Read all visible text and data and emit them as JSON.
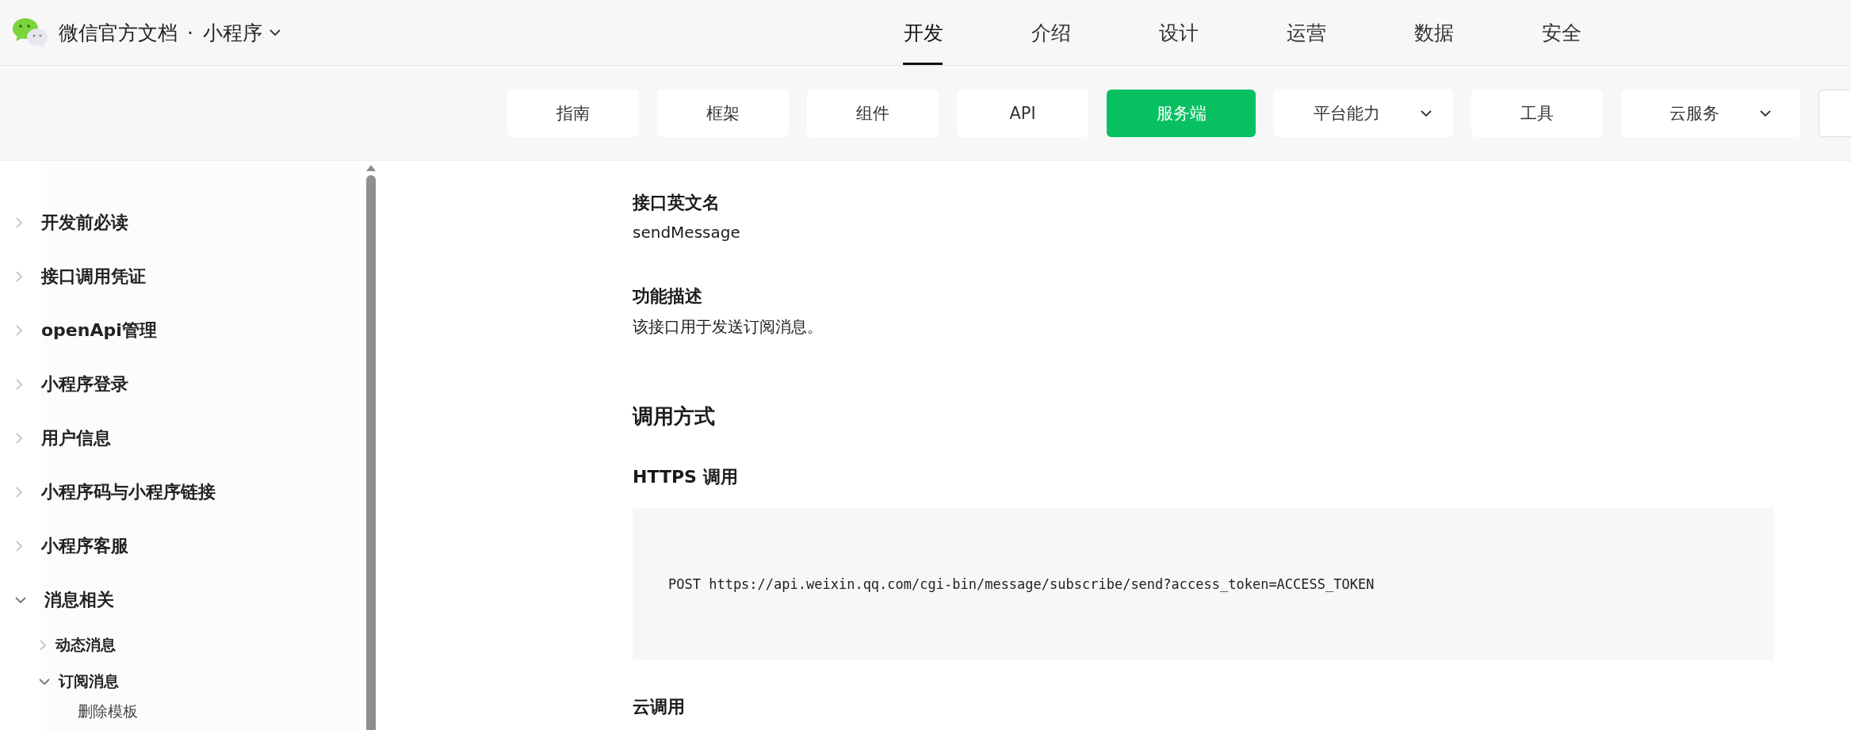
{
  "header": {
    "site_title": "微信官方文档",
    "separator": "·",
    "product": "小程序",
    "nav": [
      {
        "label": "开发",
        "selected": true
      },
      {
        "label": "介绍",
        "selected": false
      },
      {
        "label": "设计",
        "selected": false
      },
      {
        "label": "运营",
        "selected": false
      },
      {
        "label": "数据",
        "selected": false
      },
      {
        "label": "安全",
        "selected": false
      }
    ]
  },
  "subnav": [
    {
      "kind": "plain",
      "label": "指南",
      "selected": false
    },
    {
      "kind": "plain",
      "label": "框架",
      "selected": false
    },
    {
      "kind": "plain",
      "label": "组件",
      "selected": false
    },
    {
      "kind": "plain",
      "label": "API",
      "selected": false
    },
    {
      "kind": "plain",
      "label": "服务端",
      "selected": true
    },
    {
      "kind": "dropdown",
      "label": "平台能力",
      "selected": false
    },
    {
      "kind": "plain",
      "label": "工具",
      "selected": false
    },
    {
      "kind": "dropdown",
      "label": "云服务",
      "selected": false
    },
    {
      "kind": "cut",
      "selected": false
    }
  ],
  "sidebar": {
    "items": [
      {
        "label": "开发前必读",
        "expanded": false
      },
      {
        "label": "接口调用凭证",
        "expanded": false
      },
      {
        "label": "openApi管理",
        "expanded": false
      },
      {
        "label": "小程序登录",
        "expanded": false
      },
      {
        "label": "用户信息",
        "expanded": false
      },
      {
        "label": "小程序码与小程序链接",
        "expanded": false
      },
      {
        "label": "小程序客服",
        "expanded": false
      },
      {
        "label": "消息相关",
        "expanded": true,
        "children": [
          {
            "label": "动态消息",
            "expanded": false
          },
          {
            "label": "订阅消息",
            "expanded": true,
            "children": [
              {
                "label": "删除模板"
              }
            ]
          }
        ]
      }
    ]
  },
  "content": [
    {
      "kind": "heading",
      "text": "接口英文名"
    },
    {
      "kind": "text",
      "text": "sendMessage"
    },
    {
      "kind": "heading",
      "text": "功能描述"
    },
    {
      "kind": "text",
      "text": "该接口用于发送订阅消息。"
    },
    {
      "kind": "title",
      "text": "调用方式"
    },
    {
      "kind": "heading",
      "text": "HTTPS 调用"
    },
    {
      "kind": "code",
      "text": "POST https://api.weixin.qq.com/cgi-bin/message/subscribe/send?access_token=ACCESS_TOKEN"
    },
    {
      "kind": "heading",
      "text": "云调用"
    }
  ]
}
